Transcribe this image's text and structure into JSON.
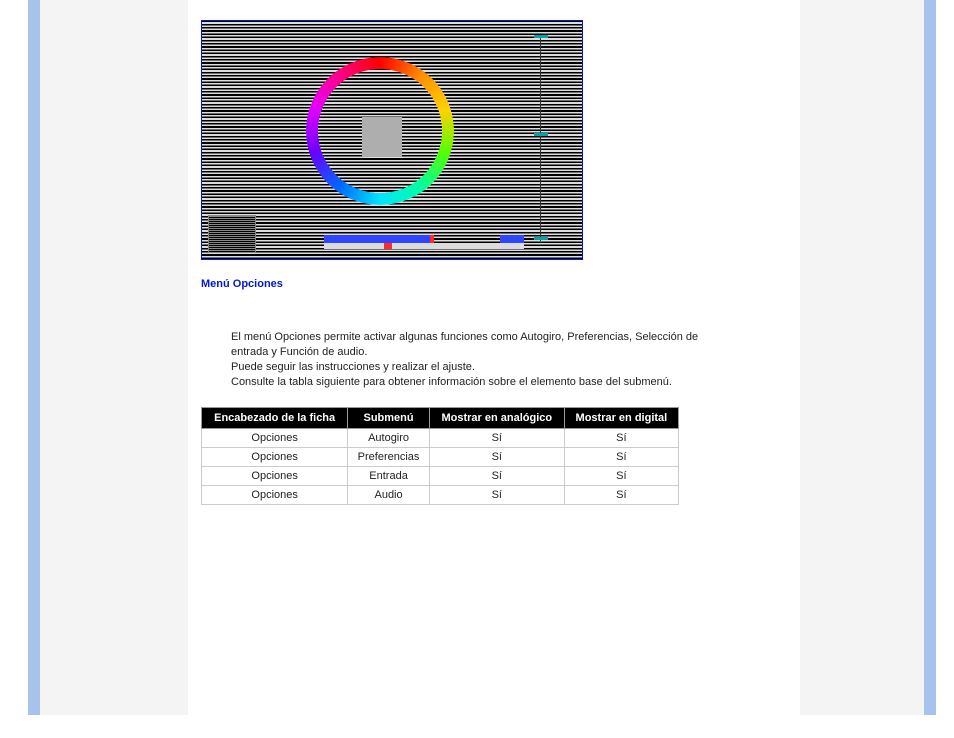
{
  "section_title": "Menú Opciones",
  "desc": {
    "p1": "El menú Opciones permite activar algunas funciones como Autogiro, Preferencias, Selección de entrada y Función de audio.",
    "p2": "Puede seguir las instrucciones y realizar el ajuste.",
    "p3": "Consulte la tabla siguiente para obtener información sobre el elemento base del submenú."
  },
  "table": {
    "headers": [
      "Encabezado de la ficha",
      "Submenú",
      "Mostrar en analógico",
      "Mostrar en digital"
    ],
    "rows": [
      [
        "Opciones",
        "Autogiro",
        "Sí",
        "Sí"
      ],
      [
        "Opciones",
        "Preferencias",
        "Sí",
        "Sí"
      ],
      [
        "Opciones",
        "Entrada",
        "Sí",
        "Sí"
      ],
      [
        "Opciones",
        "Audio",
        "Sí",
        "Sí"
      ]
    ]
  }
}
